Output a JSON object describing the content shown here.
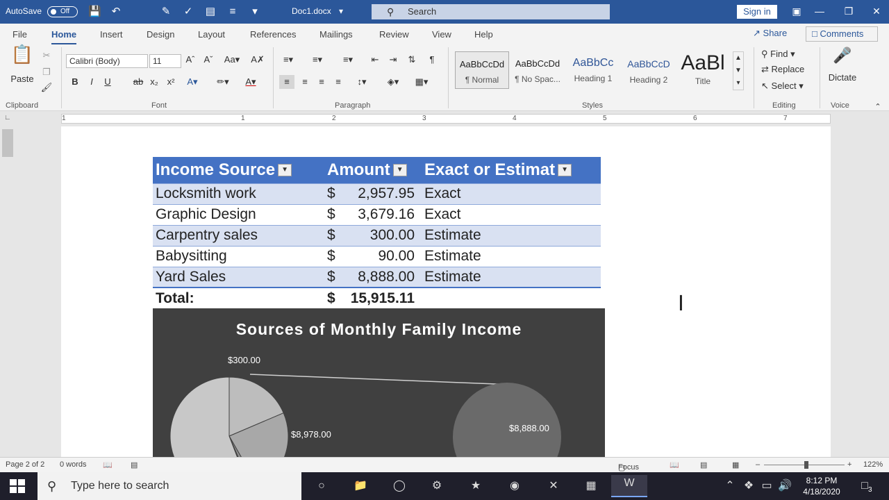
{
  "titlebar": {
    "autosave_label": "AutoSave",
    "autosave_state": "Off",
    "doc_title": "Doc1.docx",
    "search_placeholder": "Search",
    "signin_label": "Sign in"
  },
  "menu": {
    "tabs": [
      "File",
      "Home",
      "Insert",
      "Design",
      "Layout",
      "References",
      "Mailings",
      "Review",
      "View",
      "Help"
    ],
    "active_tab": "Home",
    "share_label": "Share",
    "comments_label": "Comments"
  },
  "ribbon": {
    "clipboard": {
      "paste_label": "Paste",
      "group_label": "Clipboard"
    },
    "font": {
      "font_name": "Calibri (Body)",
      "font_size": "11",
      "group_label": "Font"
    },
    "paragraph": {
      "group_label": "Paragraph"
    },
    "styles": {
      "group_label": "Styles",
      "tiles": [
        {
          "preview": "AaBbCcDd",
          "name": "¶ Normal"
        },
        {
          "preview": "AaBbCcDd",
          "name": "¶ No Spac..."
        },
        {
          "preview": "AaBbCc",
          "name": "Heading 1"
        },
        {
          "preview": "AaBbCcD",
          "name": "Heading 2"
        },
        {
          "preview": "AaBl",
          "name": "Title"
        }
      ]
    },
    "editing": {
      "find_label": "Find",
      "replace_label": "Replace",
      "select_label": "Select",
      "group_label": "Editing"
    },
    "voice": {
      "dictate_label": "Dictate",
      "group_label": "Voice"
    }
  },
  "ruler": {
    "numbers": [
      "1",
      "1",
      "2",
      "3",
      "4",
      "5",
      "6",
      "7"
    ]
  },
  "table": {
    "headers": [
      "Income Source",
      "Amount",
      "Exact or Estimat"
    ],
    "rows": [
      {
        "source": "Locksmith work",
        "currency": "$",
        "amount": "2,957.95",
        "kind": "Exact"
      },
      {
        "source": "Graphic Design",
        "currency": "$",
        "amount": "3,679.16",
        "kind": "Exact"
      },
      {
        "source": "Carpentry sales",
        "currency": "$",
        "amount": "300.00",
        "kind": "Estimate"
      },
      {
        "source": "Babysitting",
        "currency": "$",
        "amount": "90.00",
        "kind": "Estimate"
      },
      {
        "source": "Yard Sales",
        "currency": "$",
        "amount": "8,888.00",
        "kind": "Estimate"
      }
    ],
    "total_label": "Total:",
    "total_currency": "$",
    "total_amount": "15,915.11"
  },
  "chart_data": {
    "type": "pie",
    "title": "Sources of Monthly Family Income",
    "labels_visible": [
      "$300.00",
      "$8,978.00",
      "$8,888.00"
    ],
    "categories": [
      "Locksmith work",
      "Graphic Design",
      "Carpentry sales",
      "Babysitting",
      "Yard Sales"
    ],
    "values": [
      2957.95,
      3679.16,
      300.0,
      90.0,
      8888.0
    ],
    "colors": {
      "background": "#404040",
      "slice_light": "#c0c0c0",
      "slice_dark": "#6a6a6a"
    }
  },
  "statusbar": {
    "page": "Page 2 of 2",
    "words": "0 words",
    "focus_label": "Focus",
    "zoom": "122%"
  },
  "taskbar": {
    "search_placeholder": "Type here to search",
    "time": "8:12 PM",
    "date": "4/18/2020",
    "notification_count": "3"
  }
}
